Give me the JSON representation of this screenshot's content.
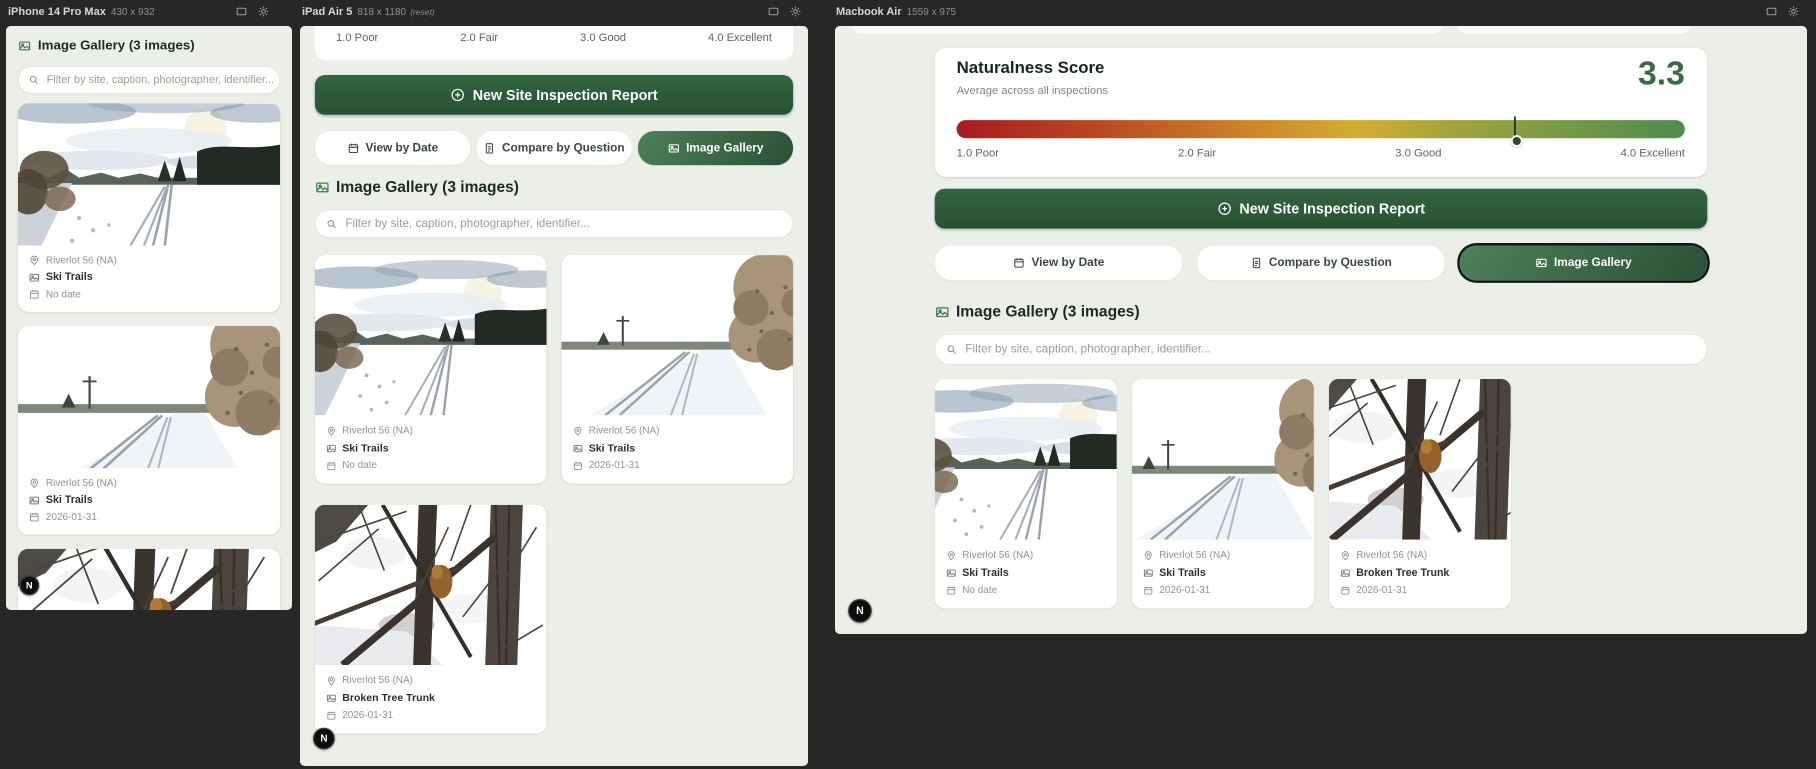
{
  "workspace": {
    "devices": [
      {
        "name": "iPhone 14 Pro Max",
        "dims": "430 x 932",
        "suffix": ""
      },
      {
        "name": "iPad Air 5",
        "dims": "818 x 1180",
        "suffix": "(reset)"
      },
      {
        "name": "Macbook Air",
        "dims": "1559 x 975",
        "suffix": ""
      }
    ],
    "toolbar_icons": [
      "device-frame-icon",
      "settings-gear-icon"
    ]
  },
  "score": {
    "title": "Naturalness Score",
    "subtitle": "Average across all inspections",
    "value": "3.3",
    "min": 1.0,
    "max": 4.0,
    "scale": [
      "1.0 Poor",
      "2.0 Fair",
      "3.0 Good",
      "4.0 Excellent"
    ],
    "gradient_colors": [
      "#a81c21",
      "#cd8429",
      "#d2ae33",
      "#4f8b4f"
    ]
  },
  "actions": {
    "new_report": "New Site Inspection Report",
    "new_report_icon": "plus-circle-icon",
    "tabs": [
      {
        "label": "View by Date",
        "icon": "calendar-icon",
        "active": false
      },
      {
        "label": "Compare by Question",
        "icon": "document-icon",
        "active": false
      },
      {
        "label": "Image Gallery",
        "icon": "image-icon",
        "active": true
      }
    ]
  },
  "gallery": {
    "heading": "Image Gallery (3 images)",
    "heading_icon": "image-icon",
    "filter_placeholder": "Filter by site, caption, photographer, identifier...",
    "items": [
      {
        "site": "Riverlot 56 (NA)",
        "caption": "Ski Trails",
        "date": "No date",
        "photo": "winter-trail-overcast"
      },
      {
        "site": "Riverlot 56 (NA)",
        "caption": "Ski Trails",
        "date": "2026-01-31",
        "photo": "winter-trail-blue-sky"
      },
      {
        "site": "Riverlot 56 (NA)",
        "caption": "Broken Tree Trunk",
        "date": "2026-01-31",
        "photo": "broken-tree-trunk"
      }
    ],
    "item_icons": [
      "map-pin-icon",
      "image-icon",
      "calendar-icon"
    ]
  },
  "dev_badge": "N",
  "colors": {
    "workspace_bg": "#272727",
    "page_bg": "#ecefe7",
    "primary_green": "#2d5b3a",
    "active_tab_green": "#35603f",
    "score_value_green": "#3a6b44"
  }
}
